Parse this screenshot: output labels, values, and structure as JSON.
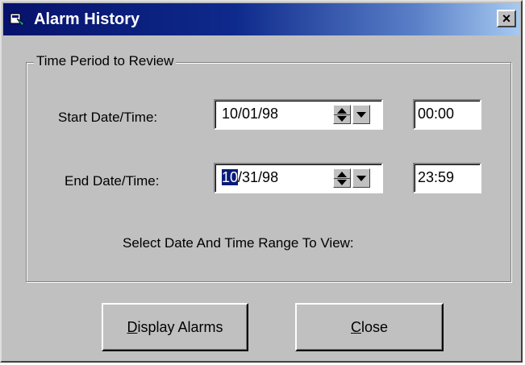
{
  "window": {
    "title": "Alarm History",
    "icon": "alarm-app-icon",
    "close_symbol": "×"
  },
  "group": {
    "label": "Time Period to Review"
  },
  "start": {
    "label": "Start Date/Time:",
    "date": "10/01/98",
    "time": "00:00"
  },
  "end": {
    "label": "End Date/Time:",
    "date_selected": "10",
    "date_rest": "/31/98",
    "time": "23:59"
  },
  "instruction": "Select Date And Time Range To View:",
  "buttons": {
    "display_accel": "D",
    "display_rest": "isplay Alarms",
    "close_accel": "C",
    "close_rest": "lose"
  },
  "colors": {
    "titlebar_start": "#07126b",
    "titlebar_end": "#a6caf0",
    "dialog_face": "#c0c0c0",
    "selection": "#0a1a7a"
  }
}
